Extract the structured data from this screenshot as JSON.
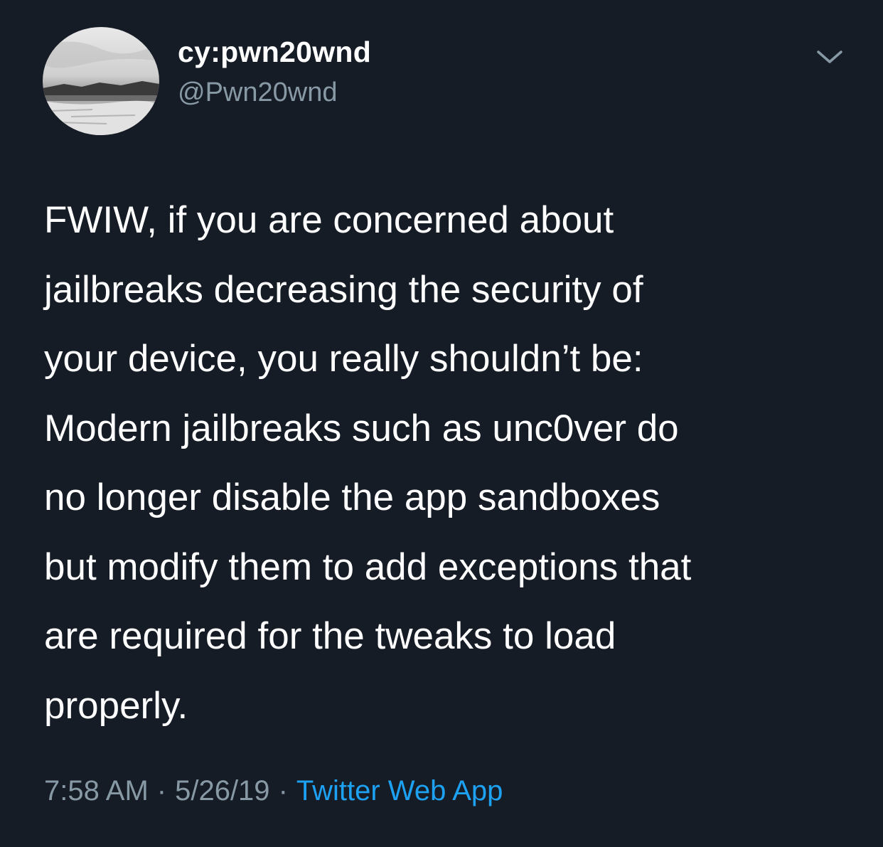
{
  "author": {
    "display_name": "cy:pwn20wnd",
    "handle": "@Pwn20wnd"
  },
  "icons": {
    "menu": "chevron-down-icon",
    "avatar": "avatar-image"
  },
  "tweet": {
    "text": "FWIW, if you are concerned about\njailbreaks decreasing the security of\nyour device, you really shouldn’t be:\nModern jailbreaks such as unc0ver do\nno longer disable the app sandboxes\nbut modify them to add exceptions that\nare required for the tweaks to load\nproperly.",
    "time": "7:58 AM",
    "separator": "·",
    "date": "5/26/19",
    "source": "Twitter Web App"
  },
  "colors": {
    "background": "#161c26",
    "primary_text": "#ffffff",
    "secondary_text": "#8899a6",
    "link": "#1da1f2"
  }
}
